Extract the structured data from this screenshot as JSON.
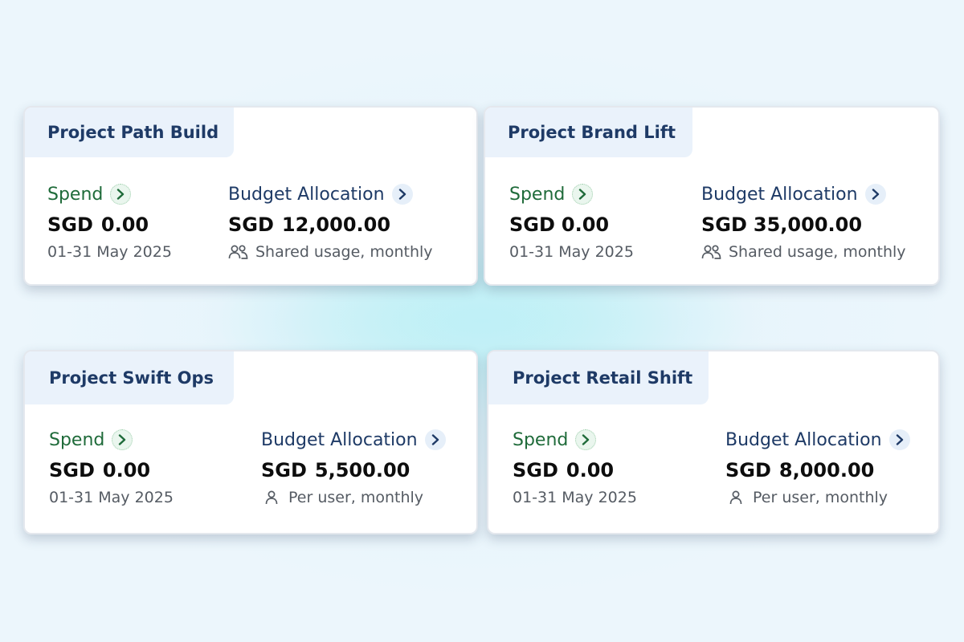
{
  "cards": [
    {
      "title": "Project Path Build",
      "spend": {
        "label": "Spend",
        "currency": "SGD",
        "amount": "0.00",
        "period": "01-31 May 2025"
      },
      "budget": {
        "label": "Budget Allocation",
        "currency": "SGD",
        "amount": "12,000.00",
        "usage": "Shared usage, monthly",
        "usage_icon": "users-icon"
      }
    },
    {
      "title": "Project Brand Lift",
      "spend": {
        "label": "Spend",
        "currency": "SGD",
        "amount": "0.00",
        "period": "01-31 May 2025"
      },
      "budget": {
        "label": "Budget Allocation",
        "currency": "SGD",
        "amount": "35,000.00",
        "usage": "Shared usage, monthly",
        "usage_icon": "users-icon"
      }
    },
    {
      "title": "Project Swift Ops",
      "spend": {
        "label": "Spend",
        "currency": "SGD",
        "amount": "0.00",
        "period": "01-31 May 2025"
      },
      "budget": {
        "label": "Budget Allocation",
        "currency": "SGD",
        "amount": "5,500.00",
        "usage": "Per user, monthly",
        "usage_icon": "user-icon"
      }
    },
    {
      "title": "Project Retail Shift",
      "spend": {
        "label": "Spend",
        "currency": "SGD",
        "amount": "0.00",
        "period": "01-31 May 2025"
      },
      "budget": {
        "label": "Budget Allocation",
        "currency": "SGD",
        "amount": "8,000.00",
        "usage": "Per user, monthly",
        "usage_icon": "user-icon"
      }
    }
  ],
  "colors": {
    "spend_label": "#1f6b3a",
    "budget_label": "#1e3a66",
    "header_bg": "#eaf2fb",
    "title_text": "#1e3a66"
  }
}
